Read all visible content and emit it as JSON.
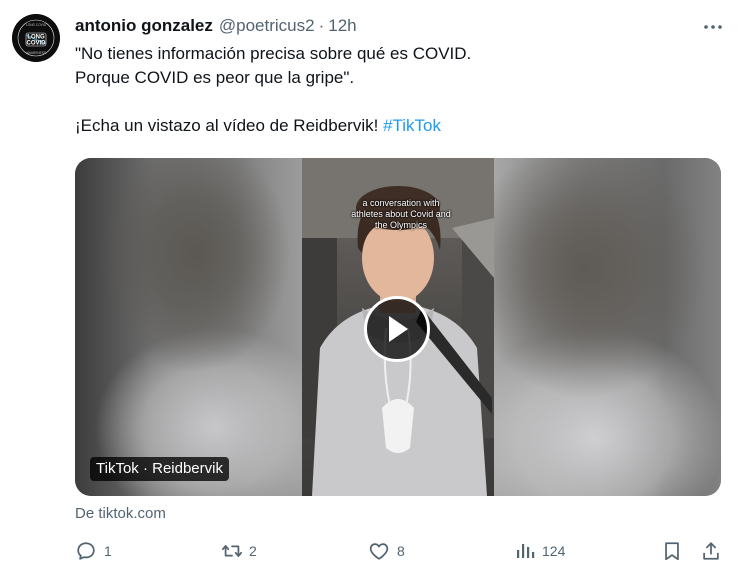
{
  "tweet": {
    "avatar_text": {
      "top": "LONG COVID",
      "line1": "LONG",
      "line2": "COVID",
      "bottom": "AWARENESS"
    },
    "author_name": "antonio gonzalez",
    "handle": "@poetricus2",
    "separator": "·",
    "time": "12h",
    "more_label": "···",
    "text_lines": [
      "\"No tienes información precisa sobre qué es COVID.",
      "Porque COVID es peor que la gripe\".",
      "¡Echa un vistazo al vídeo de Reidbervik! "
    ],
    "hashtag": "#TikTok"
  },
  "media": {
    "caption": "a conversation with athletes about Covid and the Olympics",
    "source_badge": "TikTok · Reidbervik",
    "from_label": "De tiktok.com"
  },
  "actions": {
    "reply_count": "1",
    "retweet_count": "2",
    "like_count": "8",
    "views_count": "124"
  },
  "colors": {
    "text": "#0f1419",
    "secondary": "#536471",
    "link": "#1d9bf0",
    "background": "#ffffff"
  },
  "icons": [
    "avatar-logo",
    "more-icon",
    "play-icon",
    "reply-icon",
    "retweet-icon",
    "like-icon",
    "views-icon",
    "bookmark-icon",
    "share-icon"
  ]
}
